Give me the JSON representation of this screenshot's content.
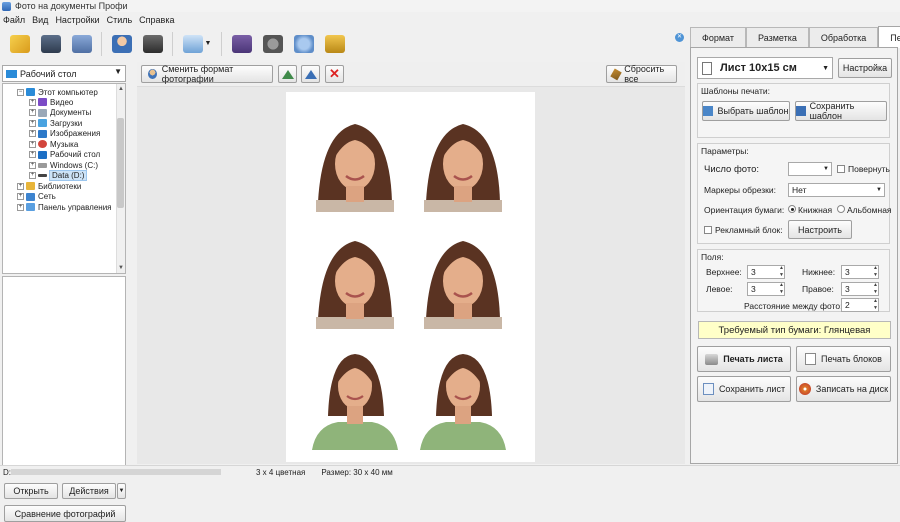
{
  "window": {
    "title": "Фото на документы Профи"
  },
  "menu": [
    "Файл",
    "Вид",
    "Настройки",
    "Стиль",
    "Справка"
  ],
  "left": {
    "location": "Рабочий стол",
    "tree": [
      {
        "label": "Этот компьютер",
        "level": 1,
        "expanded": true,
        "icon": "computer-icon"
      },
      {
        "label": "Видео",
        "level": 2,
        "icon": "video-folder-icon"
      },
      {
        "label": "Документы",
        "level": 2,
        "icon": "documents-icon"
      },
      {
        "label": "Загрузки",
        "level": 2,
        "icon": "downloads-icon"
      },
      {
        "label": "Изображения",
        "level": 2,
        "icon": "pictures-icon"
      },
      {
        "label": "Музыка",
        "level": 2,
        "icon": "music-icon"
      },
      {
        "label": "Рабочий стол",
        "level": 2,
        "icon": "desktop-icon"
      },
      {
        "label": "Windows (C:)",
        "level": 2,
        "icon": "drive-icon"
      },
      {
        "label": "Data (D:)",
        "level": 2,
        "icon": "drive-icon",
        "selected": true
      },
      {
        "label": "Библиотеки",
        "level": 1,
        "icon": "libraries-icon"
      },
      {
        "label": "Сеть",
        "level": 1,
        "icon": "network-icon"
      },
      {
        "label": "Панель управления",
        "level": 1,
        "icon": "control-panel-icon"
      }
    ],
    "open_label": "Открыть",
    "actions_label": "Действия",
    "compare_label": "Сравнение фотографий"
  },
  "center": {
    "change_format_label": "Сменить формат фотографии",
    "reset_all_label": "Сбросить все"
  },
  "right": {
    "tabs": [
      "Формат",
      "Разметка",
      "Обработка",
      "Печать"
    ],
    "active_tab": "Печать",
    "sheet_name": "Лист 10x15 см",
    "settings_label": "Настройка",
    "templates_label": "Шаблоны печати:",
    "choose_template": "Выбрать шаблон",
    "save_template": "Сохранить шаблон",
    "params_label": "Параметры:",
    "photo_count_label": "Число фото:",
    "rotate_label": "Повернуть",
    "cut_markers_label": "Маркеры обрезки:",
    "cut_markers_value": "Нет",
    "orientation_label": "Ориентация бумаги:",
    "portrait_label": "Книжная",
    "landscape_label": "Альбомная",
    "ad_block_label": "Рекламный блок:",
    "configure_label": "Настроить",
    "margins_label": "Поля:",
    "top_label": "Верхнее:",
    "top_value": "3",
    "bottom_label": "Нижнее:",
    "bottom_value": "3",
    "left_label": "Левое:",
    "left_value": "3",
    "right_label": "Правое:",
    "right_value": "3",
    "spacing_label": "Расстояние между фото:",
    "spacing_value": "2",
    "paper_type": "Требуемый тип бумаги: Глянцевая",
    "print_sheet": "Печать листа",
    "print_blocks": "Печать блоков",
    "save_sheet": "Сохранить лист",
    "write_disk": "Записать на диск"
  },
  "status": {
    "path": "D:\\",
    "layout": "3 х 4 цветная",
    "size": "Размер: 30 х 40 мм"
  }
}
